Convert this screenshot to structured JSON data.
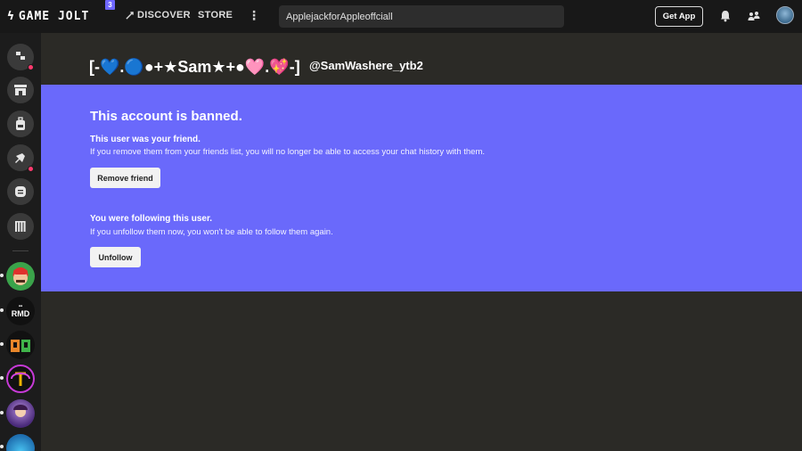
{
  "topbar": {
    "logo_text": "GAME JOLT",
    "logo_badge": "3",
    "discover_label": "DISCOVER",
    "store_label": "STORE",
    "more_label": "⋮",
    "search_value": "ApplejackforAppleoffciall",
    "get_app_label": "Get App",
    "icons": [
      "bell-icon",
      "friends-icon",
      "user-avatar"
    ]
  },
  "sidebar": {
    "nav_icons": [
      "activity-icon",
      "store-icon",
      "backpack-icon",
      "creator-icon",
      "chat-icon",
      "library-icon"
    ],
    "notification_color": "#ff3a6e",
    "game_icons": [
      "game-icon-1",
      "game-icon-2",
      "game-icon-3",
      "game-icon-4",
      "game-icon-5",
      "game-icon-6"
    ],
    "game_2_label": "RMD"
  },
  "profile": {
    "display_name": "[-💙.🔵●+★Sam★+●🩷.💖-]",
    "handle": "@SamWashere_ytb2"
  },
  "banned": {
    "title": "This account is banned.",
    "friend_heading": "This user was your friend.",
    "friend_text": "If you remove them from your friends list, you will no longer be able to access your chat history with them.",
    "remove_friend_label": "Remove friend",
    "follow_heading": "You were following this user.",
    "follow_text": "If you unfollow them now, you won't be able to follow them again.",
    "unfollow_label": "Unfollow",
    "panel_color": "#6a69fb"
  }
}
